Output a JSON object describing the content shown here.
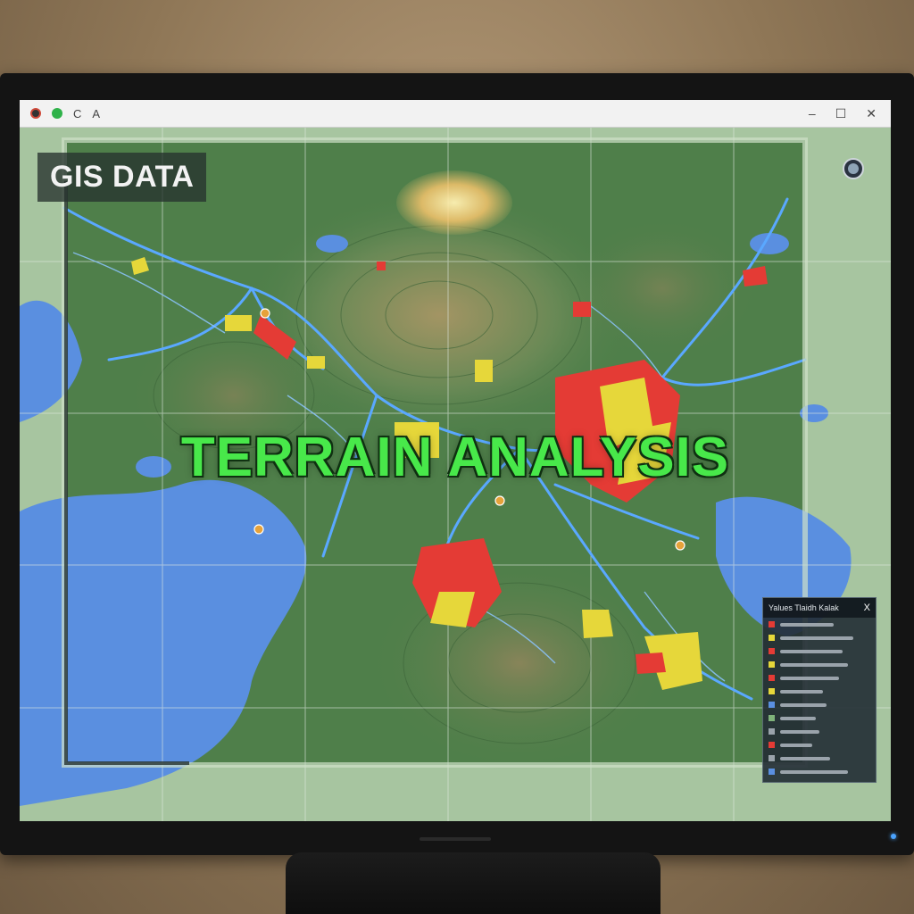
{
  "window": {
    "reload_label": "C",
    "address_text": "A",
    "minimize_glyph": "–",
    "maximize_glyph": "☐",
    "close_glyph": "✕"
  },
  "map": {
    "corner_label": "GIS DATA",
    "title": "TERRAIN ANALYSIS",
    "colors": {
      "water": "#5a8fe0",
      "terrain": "#4f7f4a",
      "roads": "#5aa8ff",
      "zone_red": "#e43b35",
      "zone_yellow": "#e6d73a",
      "title_green": "#48e84a"
    }
  },
  "legend": {
    "title": "Yalues Tlaidh Kalak",
    "close_glyph": "X",
    "items": [
      {
        "color": "#e43b35"
      },
      {
        "color": "#e6d73a"
      },
      {
        "color": "#e43b35"
      },
      {
        "color": "#e6d73a"
      },
      {
        "color": "#e43b35"
      },
      {
        "color": "#e6d73a"
      },
      {
        "color": "#5a8fe0"
      },
      {
        "color": "#7fb37a"
      },
      {
        "color": "#9aa3ab"
      },
      {
        "color": "#e43b35"
      },
      {
        "color": "#9aa3ab"
      },
      {
        "color": "#5a8fe0"
      }
    ]
  },
  "icons": {
    "globe": "globe-icon",
    "marker": "map-marker-icon"
  }
}
